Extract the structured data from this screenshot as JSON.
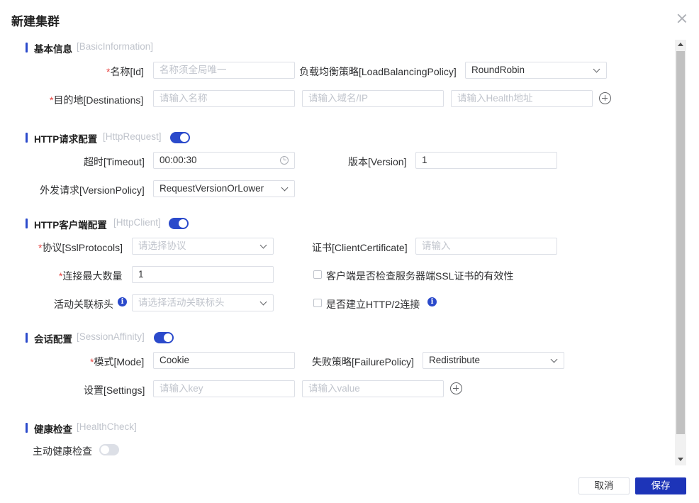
{
  "dialog": {
    "title": "新建集群"
  },
  "sections": {
    "basic": {
      "title": "基本信息",
      "sub": "[BasicInformation]"
    },
    "http_request": {
      "title": "HTTP请求配置",
      "sub": "[HttpRequest]",
      "enabled": true
    },
    "http_client": {
      "title": "HTTP客户端配置",
      "sub": "[HttpClient]",
      "enabled": true
    },
    "session": {
      "title": "会话配置",
      "sub": "[SessionAffinity]",
      "enabled": true
    },
    "health": {
      "title": "健康检查",
      "sub": "[HealthCheck]"
    }
  },
  "basic": {
    "name_label": "名称[Id]",
    "name_placeholder": "名称须全局唯一",
    "lb_label": "负载均衡策略[LoadBalancingPolicy]",
    "lb_value": "RoundRobin",
    "dest_label": "目的地[Destinations]",
    "dest_name_placeholder": "请输入名称",
    "dest_domain_placeholder": "请输入域名/IP",
    "dest_health_placeholder": "请输入Health地址"
  },
  "http_request": {
    "timeout_label": "超时[Timeout]",
    "timeout_value": "00:00:30",
    "version_label": "版本[Version]",
    "version_value": "1",
    "version_policy_label": "外发请求[VersionPolicy]",
    "version_policy_value": "RequestVersionOrLower"
  },
  "http_client": {
    "ssl_label": "协议[SslProtocols]",
    "ssl_placeholder": "请选择协议",
    "cert_label": "证书[ClientCertificate]",
    "cert_placeholder": "请输入",
    "max_conn_label": "连接最大数量",
    "max_conn_value": "1",
    "check_cert_label": "客户端是否检查服务器端SSL证书的有效性",
    "activity_label": "活动关联标头",
    "activity_placeholder": "请选择活动关联标头",
    "http2_label": "是否建立HTTP/2连接"
  },
  "session": {
    "mode_label": "模式[Mode]",
    "mode_value": "Cookie",
    "failure_label": "失败策略[FailurePolicy]",
    "failure_value": "Redistribute",
    "settings_label": "设置[Settings]",
    "key_placeholder": "请输入key",
    "value_placeholder": "请输入value"
  },
  "health": {
    "active_label": "主动健康检查",
    "active_enabled": false
  },
  "footer": {
    "cancel": "取消",
    "save": "保存"
  },
  "common": {
    "required_mark": "*",
    "info_glyph": "i"
  },
  "colors": {
    "accent": "#2b4acb",
    "primary_button": "#1d34b8",
    "required": "#e64340"
  }
}
